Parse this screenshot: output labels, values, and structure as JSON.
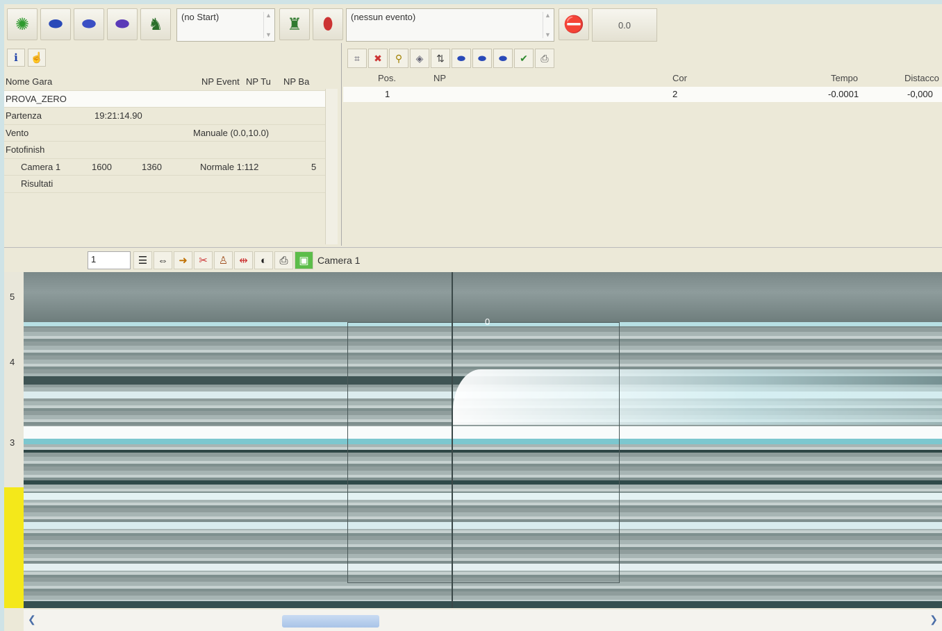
{
  "toolbar": {
    "start_combo": "(no Start)",
    "event_combo": "(nessun evento)",
    "time_value": "0.0"
  },
  "race_panel": {
    "headers": {
      "name": "Nome Gara",
      "events": "NP Event",
      "tu": "NP Tu",
      "ba": "NP Ba"
    },
    "race_name": "PROVA_ZERO",
    "rows": [
      {
        "label": "Partenza",
        "value": "19:21:14.90",
        "extra": ""
      },
      {
        "label": "Vento",
        "value": "",
        "extra": "Manuale (0.0,10.0)"
      },
      {
        "label": "Fotofinish",
        "value": "",
        "extra": ""
      }
    ],
    "camera_row": {
      "label": "Camera 1",
      "a": "1600",
      "b": "1360",
      "mode": "Normale 1:112",
      "n": "5"
    },
    "results_row": {
      "label": "Risultati"
    }
  },
  "results_table": {
    "headers": {
      "pos": "Pos.",
      "np": "NP",
      "cor": "Cor",
      "tempo": "Tempo",
      "distacco": "Distacco"
    },
    "rows": [
      {
        "pos": "1",
        "np": "",
        "cor": "2",
        "tempo": "-0.0001",
        "distacco": "-0,000"
      }
    ]
  },
  "camera_toolbar": {
    "frame_value": "1",
    "camera_label": "Camera 1"
  },
  "viewport": {
    "lane_labels": [
      "5",
      "4",
      "3"
    ],
    "cursor_label": "0"
  }
}
